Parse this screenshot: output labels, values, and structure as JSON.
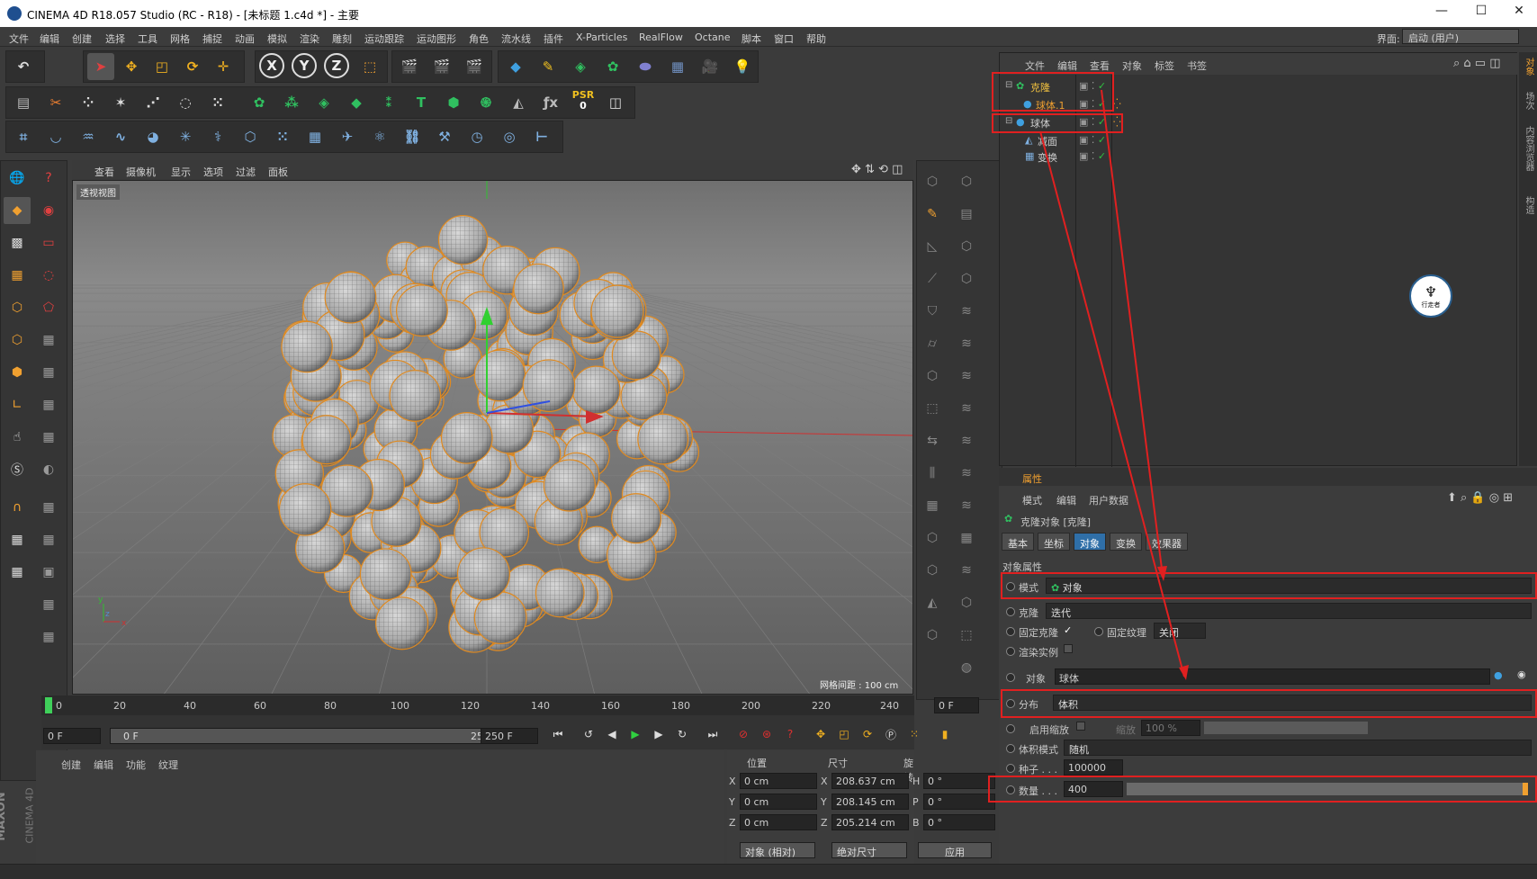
{
  "window": {
    "title": "CINEMA 4D R18.057 Studio (RC - R18) - [未标题 1.c4d *] - 主要",
    "min": "—",
    "max": "☐",
    "close": "✕"
  },
  "menu": [
    "文件",
    "编辑",
    "创建",
    "选择",
    "工具",
    "网格",
    "捕捉",
    "动画",
    "模拟",
    "渲染",
    "雕刻",
    "运动跟踪",
    "运动图形",
    "角色",
    "流水线",
    "插件",
    "X-Particles",
    "RealFlow",
    "Octane",
    "脚本",
    "窗口",
    "帮助"
  ],
  "layout": {
    "label": "界面:",
    "value": "启动 (用户)"
  },
  "toolbar": {
    "psr_label": "PSR",
    "psr_value": "0"
  },
  "viewport": {
    "menu": [
      "查看",
      "摄像机",
      "显示",
      "选项",
      "过滤",
      "面板"
    ],
    "name": "透视视图",
    "grid": "网格间距 : 100 cm"
  },
  "timeline": {
    "ticks": [
      "0",
      "20",
      "40",
      "60",
      "80",
      "100",
      "120",
      "140",
      "160",
      "180",
      "200",
      "220",
      "240"
    ],
    "frame_right": "0 F",
    "start": "0 F",
    "range_start": "0 F",
    "range_end": "250 F",
    "end": "250 F"
  },
  "materials": {
    "menu": [
      "创建",
      "编辑",
      "功能",
      "纹理"
    ]
  },
  "coords": {
    "headers": [
      "位置",
      "尺寸",
      "旋转"
    ],
    "rows": [
      {
        "axis": "X",
        "pos": "0 cm",
        "saxis": "X",
        "size": "208.637 cm",
        "raxis": "H",
        "rot": "0 °"
      },
      {
        "axis": "Y",
        "pos": "0 cm",
        "saxis": "Y",
        "size": "208.145 cm",
        "raxis": "P",
        "rot": "0 °"
      },
      {
        "axis": "Z",
        "pos": "0 cm",
        "saxis": "Z",
        "size": "205.214 cm",
        "raxis": "B",
        "rot": "0 °"
      }
    ],
    "mode": "对象 (相对)",
    "size_mode": "绝对尺寸",
    "apply": "应用"
  },
  "objects": {
    "menu": [
      "文件",
      "编辑",
      "查看",
      "对象",
      "标签",
      "书签"
    ],
    "tree": [
      {
        "name": "克隆",
        "color": "#f0c040"
      },
      {
        "name": "球体.1",
        "color": "#f0a030"
      },
      {
        "name": "球体",
        "color": "#cfcfcf"
      },
      {
        "name": "减面",
        "color": "#cfcfcf"
      },
      {
        "name": "变换",
        "color": "#cfcfcf"
      }
    ]
  },
  "side_tabs": [
    "对象",
    "场次",
    "内容浏览器",
    "构造"
  ],
  "watermark": "行走者",
  "attributes": {
    "header": "属性",
    "menu": [
      "模式",
      "编辑",
      "用户数据"
    ],
    "object_title": "克隆对象 [克隆]",
    "tabs": [
      "基本",
      "坐标",
      "对象",
      "变换",
      "效果器"
    ],
    "selected_tab": "对象",
    "section": "对象属性",
    "mode_label": "模式",
    "mode_value": "对象",
    "clone_label": "克隆",
    "clone_value": "迭代",
    "fix_clone": "固定克隆",
    "fix_texture": "固定纹理",
    "fix_texture_value": "关闭",
    "render_instance": "渲染实例",
    "object_label": "对象",
    "object_value": "球体",
    "distribution_label": "分布",
    "distribution_value": "体积",
    "enable_scale": "启用缩放",
    "scale_label": "缩放",
    "scale_value": "100 %",
    "volume_mode_label": "体积模式",
    "volume_mode_value": "随机",
    "seed_label": "种子 . . .",
    "seed_value": "100000",
    "count_label": "数量 . . .",
    "count_value": "400"
  },
  "brand": {
    "line1": "MAXON",
    "line2": "CINEMA 4D"
  },
  "colors": {
    "accent": "#f0a030",
    "selected_tab": "#2f6fa8",
    "annotation": "#e02020"
  }
}
